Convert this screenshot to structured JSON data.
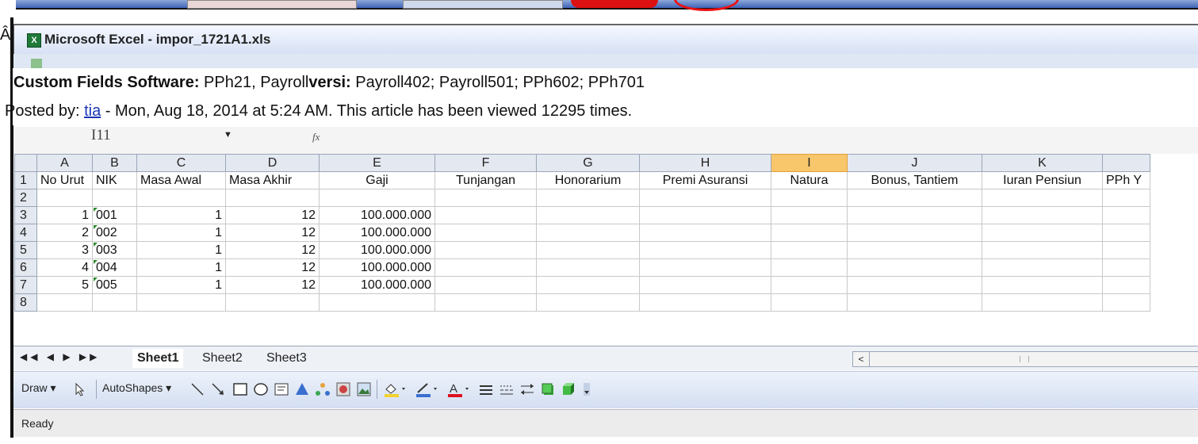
{
  "window": {
    "title": "Microsoft Excel - impor_1721A1.xls"
  },
  "article": {
    "custom_fields_label": "Custom Fields Software:",
    "software_value": " PPh21, Payroll",
    "versi_label": "versi:",
    "versi_value": " Payroll402; Payroll501; PPh602; PPh701",
    "posted_by_prefix": "Posted by: ",
    "author": "tia",
    "posted_suffix": " - Mon, Aug 18, 2014 at 5:24 AM. This article has been viewed 12295 times."
  },
  "formula_bar": {
    "name_box": "I11",
    "fx_symbol": "fx"
  },
  "sheet": {
    "columns": [
      "A",
      "B",
      "C",
      "D",
      "E",
      "F",
      "G",
      "H",
      "I",
      "J",
      "K",
      ""
    ],
    "selected_column": "I",
    "row_numbers": [
      "1",
      "2",
      "3",
      "4",
      "5",
      "6",
      "7",
      "8"
    ],
    "headers": [
      "No Urut",
      "NIK",
      "Masa Awal",
      "Masa Akhir",
      "Gaji",
      "Tunjangan",
      "Honorarium",
      "Premi Asuransi",
      "Natura",
      "Bonus, Tantiem",
      "Iuran Pensiun",
      "PPh Y"
    ],
    "rows": [
      [
        "1",
        "001",
        "1",
        "12",
        "100.000.000"
      ],
      [
        "2",
        "002",
        "1",
        "12",
        "100.000.000"
      ],
      [
        "3",
        "003",
        "1",
        "12",
        "100.000.000"
      ],
      [
        "4",
        "004",
        "1",
        "12",
        "100.000.000"
      ],
      [
        "5",
        "005",
        "1",
        "12",
        "100.000.000"
      ]
    ]
  },
  "tabs": {
    "items": [
      "Sheet1",
      "Sheet2",
      "Sheet3"
    ],
    "active": "Sheet1"
  },
  "drawing_toolbar": {
    "draw_label": "Draw ▾",
    "autoshapes_label": "AutoShapes ▾"
  },
  "status_bar": {
    "text": "Ready"
  },
  "stray_char": "Â"
}
